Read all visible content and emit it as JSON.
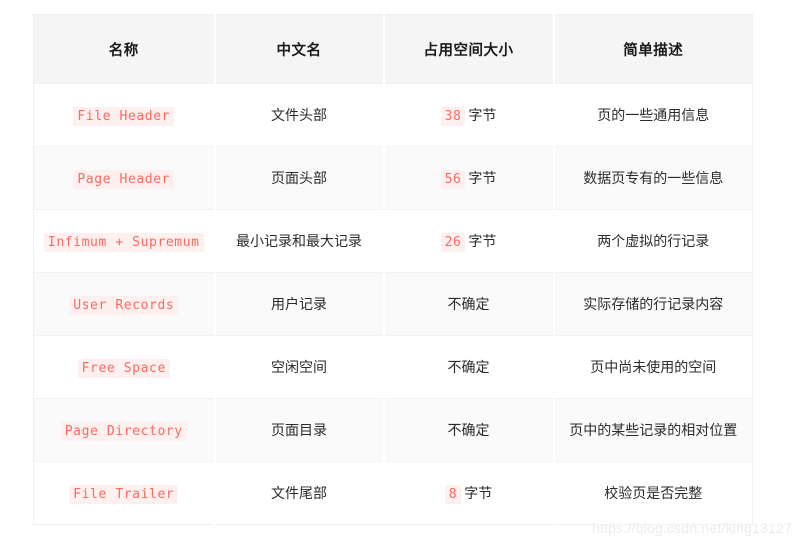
{
  "table": {
    "columns": [
      {
        "key": "name",
        "label": "名称"
      },
      {
        "key": "cn_name",
        "label": "中文名"
      },
      {
        "key": "size",
        "label": "占用空间大小"
      },
      {
        "key": "desc",
        "label": "简单描述"
      }
    ],
    "rows": [
      {
        "name": "File Header",
        "cn_name": "文件头部",
        "size_value": "38",
        "size_unit": "字节",
        "size_is_code": true,
        "size_plain": "",
        "desc": "页的一些通用信息"
      },
      {
        "name": "Page Header",
        "cn_name": "页面头部",
        "size_value": "56",
        "size_unit": "字节",
        "size_is_code": true,
        "size_plain": "",
        "desc": "数据页专有的一些信息"
      },
      {
        "name": "Infimum + Supremum",
        "cn_name": "最小记录和最大记录",
        "size_value": "26",
        "size_unit": "字节",
        "size_is_code": true,
        "size_plain": "",
        "desc": "两个虚拟的行记录"
      },
      {
        "name": "User Records",
        "cn_name": "用户记录",
        "size_value": "",
        "size_unit": "",
        "size_is_code": false,
        "size_plain": "不确定",
        "desc": "实际存储的行记录内容"
      },
      {
        "name": "Free Space",
        "cn_name": "空闲空间",
        "size_value": "",
        "size_unit": "",
        "size_is_code": false,
        "size_plain": "不确定",
        "desc": "页中尚未使用的空间"
      },
      {
        "name": "Page Directory",
        "cn_name": "页面目录",
        "size_value": "",
        "size_unit": "",
        "size_is_code": false,
        "size_plain": "不确定",
        "desc": "页中的某些记录的相对位置"
      },
      {
        "name": "File Trailer",
        "cn_name": "文件尾部",
        "size_value": "8",
        "size_unit": "字节",
        "size_is_code": true,
        "size_plain": "",
        "desc": "校验页是否完整"
      }
    ]
  },
  "watermark": {
    "text": "https://blog.csdn.net/king13127"
  },
  "colors": {
    "code_text": "#fa6a63",
    "code_background": "#fdf0ef",
    "header_background": "#f5f5f5",
    "stripe_background": "#fafafa",
    "border": "#f0f0f0",
    "watermark": "#ececec"
  }
}
